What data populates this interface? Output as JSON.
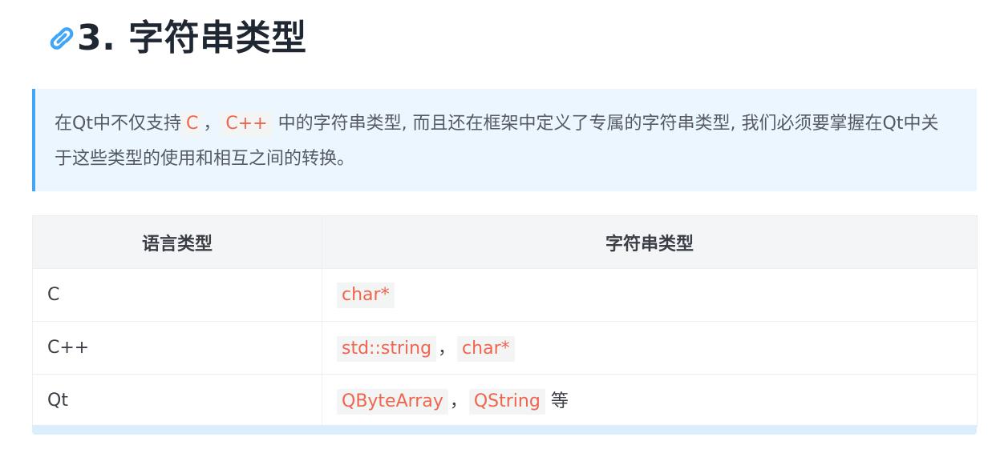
{
  "heading": {
    "text": "3. 字符串类型",
    "anchor_icon": "link-icon",
    "accent_color": "#42a5f5"
  },
  "note": {
    "before_c": "在Qt中不仅支持",
    "code_c": "C",
    "sep1": "，",
    "code_cpp": "C++",
    "after_codes": " 中的字符串类型, 而且还在框架中定义了专属的字符串类型, 我们必须要掌握在Qt中关于这些类型的使用和相互之间的转换。"
  },
  "table": {
    "headers": [
      "语言类型",
      "字符串类型"
    ],
    "rows": [
      {
        "language": "C",
        "types": [
          "char*"
        ],
        "suffix": ""
      },
      {
        "language": "C++",
        "types": [
          "std::string",
          "char*"
        ],
        "suffix": ""
      },
      {
        "language": "Qt",
        "types": [
          "QByteArray",
          "QString"
        ],
        "suffix": " 等"
      }
    ],
    "separator": "，"
  },
  "colors": {
    "code_text": "#f0654f",
    "code_bg": "#f3f4f4",
    "quote_bg": "#ebf6fe",
    "table_header_bg": "#f4f5f6"
  }
}
